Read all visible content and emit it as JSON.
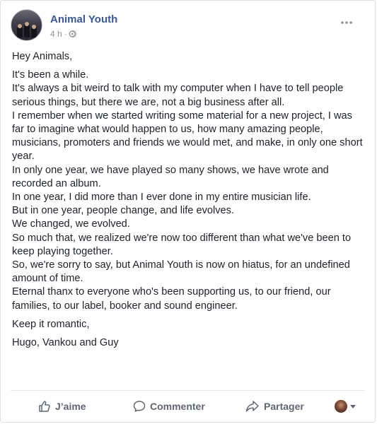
{
  "header": {
    "page_name": "Animal Youth",
    "time": "4 h",
    "separator": "·",
    "audience_icon": "globe-icon"
  },
  "post": {
    "greeting": "Hey Animals,",
    "body_lines": [
      "It's been a while.",
      "It's always a bit weird to talk with my computer when I have to tell people serious things, but there we are, not a big business after all.",
      "I remember when we started writing some material for a new project, I was far to imagine what would happen to us, how many amazing people, musicians, promoters and friends we would met, and make, in only one short year.",
      "In only one year, we have played so many shows, we have wrote and recorded an album.",
      "In one year, I did more than I ever done in my entire musician life.",
      "But in one year, people change, and life evolves.",
      "We changed, we evolved.",
      "So much that, we realized we're now too different than what we've been to keep playing together.",
      "So, we're sorry to say, but Animal Youth is now on hiatus, for an undefined amount of time.",
      "Eternal thanx to everyone who's been supporting us, to our friend, our families, to our label, booker and sound engineer."
    ],
    "closing": "Keep it romantic,",
    "signature": "Hugo, Vankou and Guy"
  },
  "actions": {
    "like_label": "J’aime",
    "comment_label": "Commenter",
    "share_label": "Partager"
  },
  "colors": {
    "page_name": "#385898",
    "meta": "#90949c",
    "text": "#1d2129",
    "action": "#606770"
  }
}
